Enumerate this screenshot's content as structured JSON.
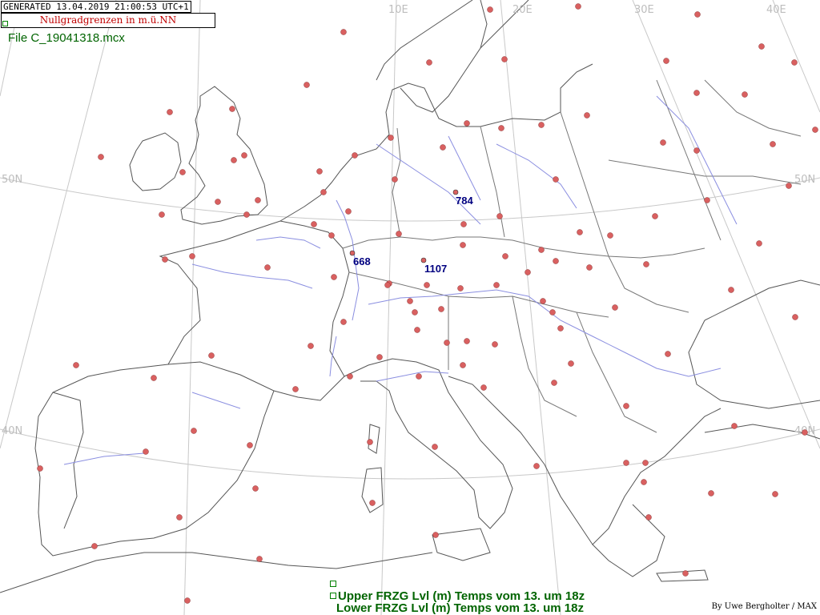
{
  "header": {
    "generated": "GENERATED 13.04.2019 21:00:53 UTC+1",
    "title": "Nullgradgrenzen in m.ü.NN",
    "file": "File C_19041318.mcx"
  },
  "grid_labels": {
    "lon": [
      "10E",
      "20E",
      "30E",
      "40E"
    ],
    "lat": [
      "50N",
      "40N"
    ]
  },
  "observations": [
    {
      "value": "784"
    },
    {
      "value": "668"
    },
    {
      "value": "1107"
    }
  ],
  "legend": {
    "upper": "Upper FRZG Lvl (m)  Temps vom 13. um 18z",
    "lower": "Lower FRZG Lvl (m)  Temps vom 13. um 18z"
  },
  "credit": "By Uwe Bergholter / MAX",
  "colors": {
    "station_marker": "#d96060",
    "graticule": "#bdbdbd",
    "coastline": "#555555",
    "river": "#8a8ee0",
    "title_text": "#c00000",
    "label_text": "#006400",
    "value_text": "#000080"
  }
}
